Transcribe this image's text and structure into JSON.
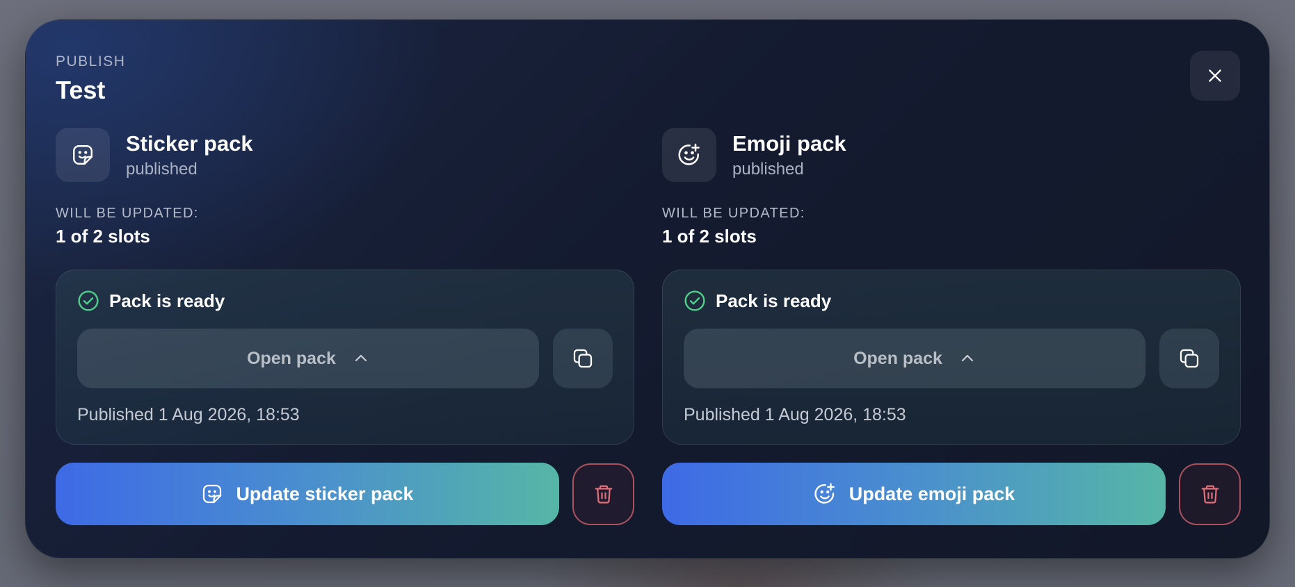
{
  "dialog": {
    "eyebrow": "PUBLISH",
    "title": "Test",
    "close_icon": "close-icon"
  },
  "packs": [
    {
      "name": "Sticker pack",
      "status": "published",
      "icon": "sticker-icon",
      "will_be_updated_label": "WILL BE UPDATED:",
      "will_be_updated_value": "1 of 2 slots",
      "ready_text": "Pack is ready",
      "open_label": "Open pack",
      "published_text": "Published 1 Aug 2026, 18:53",
      "update_label": "Update sticker pack"
    },
    {
      "name": "Emoji pack",
      "status": "published",
      "icon": "emoji-add-icon",
      "will_be_updated_label": "WILL BE UPDATED:",
      "will_be_updated_value": "1 of 2 slots",
      "ready_text": "Pack is ready",
      "open_label": "Open pack",
      "published_text": "Published 1 Aug 2026, 18:53",
      "update_label": "Update emoji pack"
    }
  ],
  "colors": {
    "accent_start": "#3e6ae6",
    "accent_end": "#56b6a6",
    "success": "#4fd18b",
    "danger": "#dc646e"
  }
}
